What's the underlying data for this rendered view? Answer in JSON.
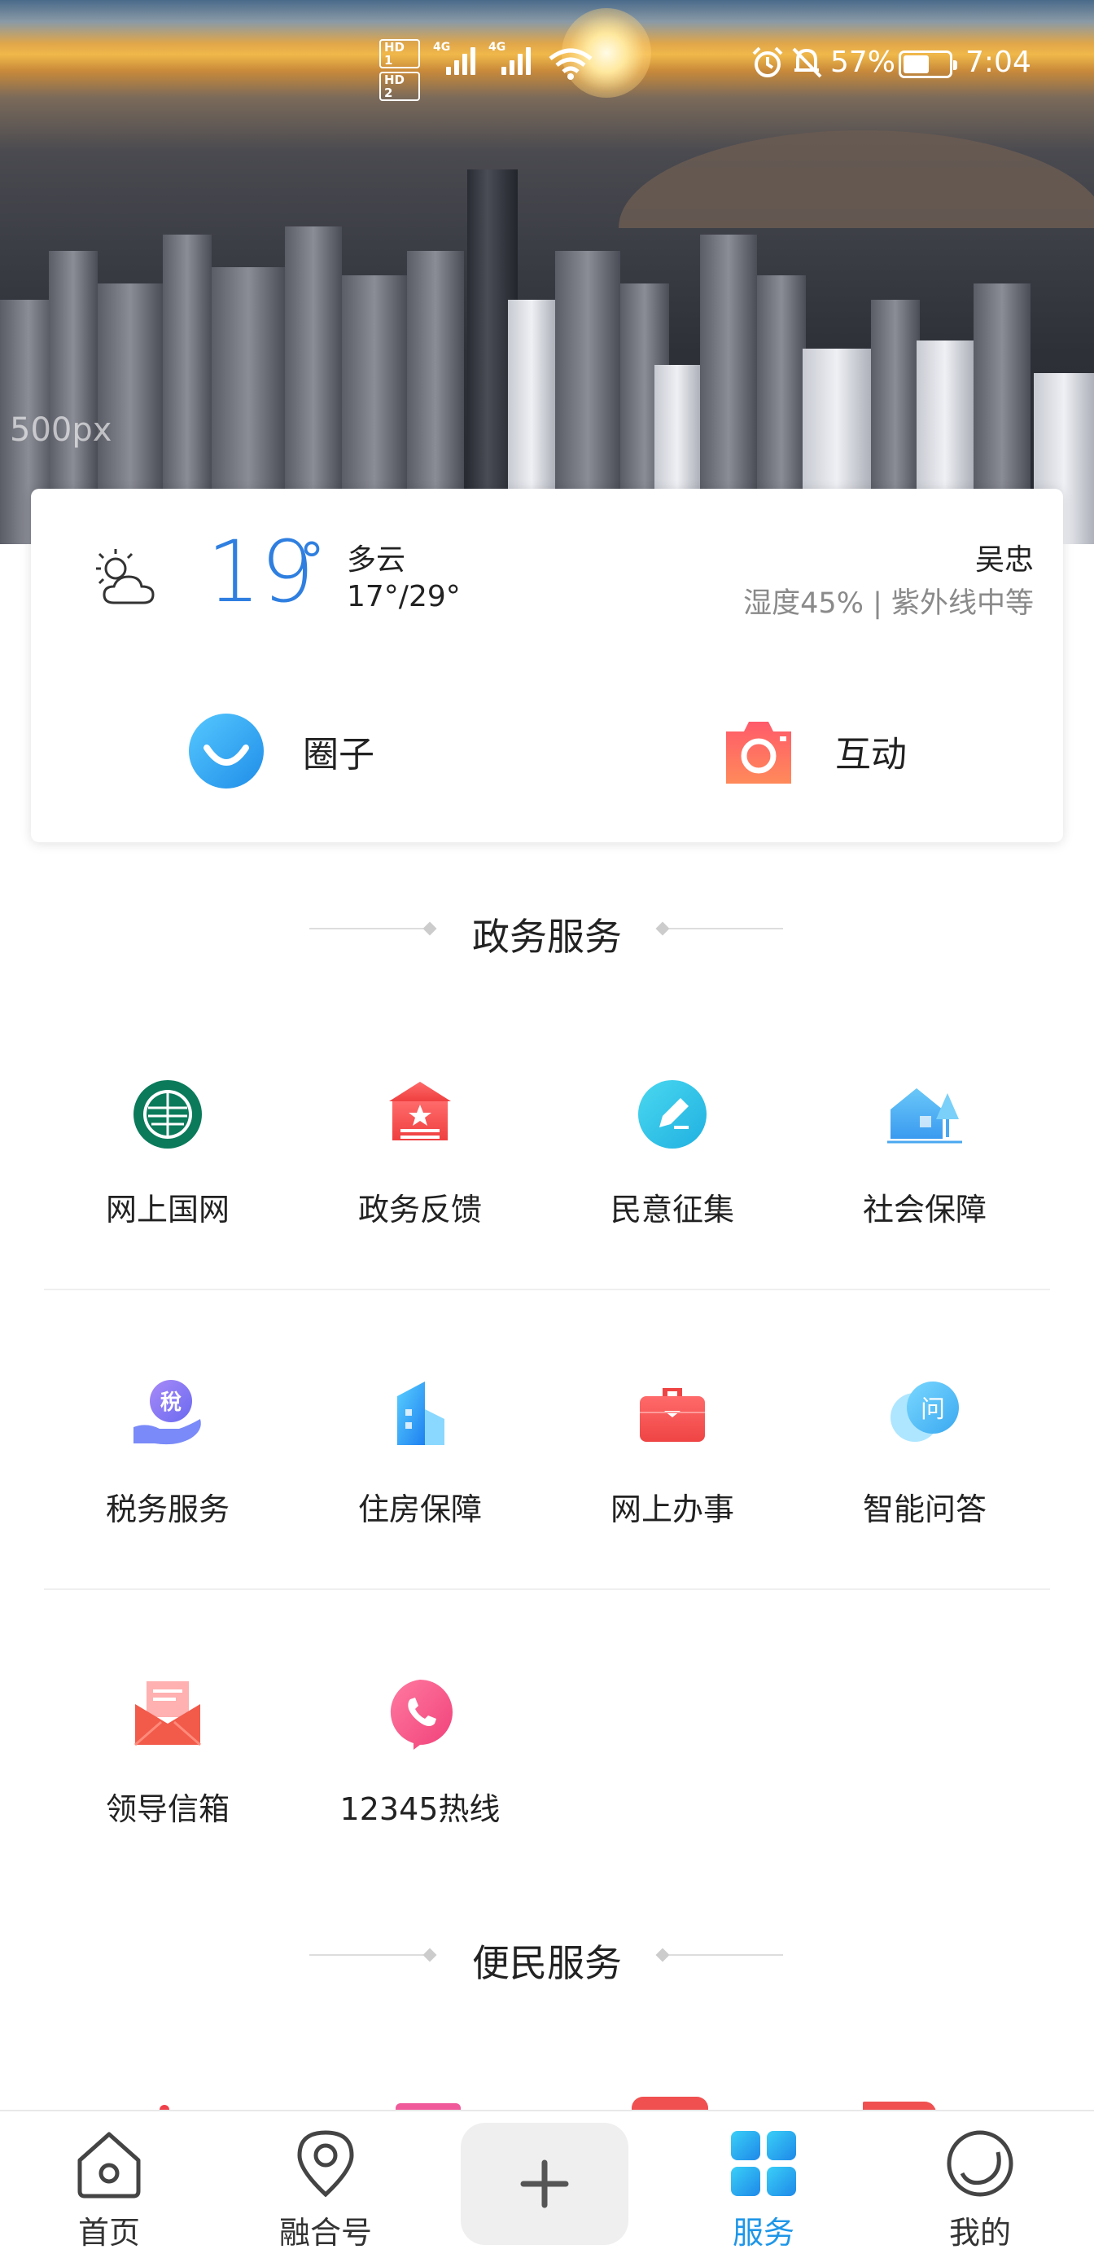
{
  "status_bar": {
    "hd1": "HD 1",
    "hd2": "HD 2",
    "net1": "4G",
    "net2": "4G",
    "battery_text": "57%",
    "battery_level": 0.57,
    "time": "7:04"
  },
  "hero": {
    "watermark": "500px"
  },
  "weather": {
    "temperature": "19",
    "degree_symbol": "°",
    "condition": "多云",
    "range": "17°/29°",
    "location": "吴忠",
    "detail": "湿度45% | 紫外线中等"
  },
  "quick_actions": [
    {
      "label": "圈子",
      "icon": "smile-bubble-icon",
      "color": "#2fa8f0"
    },
    {
      "label": "互动",
      "icon": "camera-icon",
      "color": "#f25a5a"
    }
  ],
  "gov_section": {
    "title": "政务服务",
    "items": [
      {
        "label": "网上国网",
        "icon": "state-grid-logo-icon"
      },
      {
        "label": "政务反馈",
        "icon": "government-building-icon"
      },
      {
        "label": "民意征集",
        "icon": "pen-edit-icon"
      },
      {
        "label": "社会保障",
        "icon": "house-tree-icon"
      },
      {
        "label": "税务服务",
        "icon": "tax-hand-icon"
      },
      {
        "label": "住房保障",
        "icon": "building-icon"
      },
      {
        "label": "网上办事",
        "icon": "briefcase-icon"
      },
      {
        "label": "智能问答",
        "icon": "chat-question-icon"
      },
      {
        "label": "领导信箱",
        "icon": "mail-envelope-icon"
      },
      {
        "label": "12345热线",
        "icon": "phone-icon"
      }
    ]
  },
  "convenience_section": {
    "title": "便民服务"
  },
  "bottom_nav": [
    {
      "label": "首页",
      "icon": "home-icon",
      "active": false
    },
    {
      "label": "融合号",
      "icon": "location-pin-icon",
      "active": false
    },
    {
      "label": "",
      "icon": "plus-icon",
      "active": false
    },
    {
      "label": "服务",
      "icon": "grid-apps-icon",
      "active": true
    },
    {
      "label": "我的",
      "icon": "profile-circle-icon",
      "active": false
    }
  ],
  "colors": {
    "accent": "#1e96e8",
    "temperature": "#2f7fe0"
  }
}
